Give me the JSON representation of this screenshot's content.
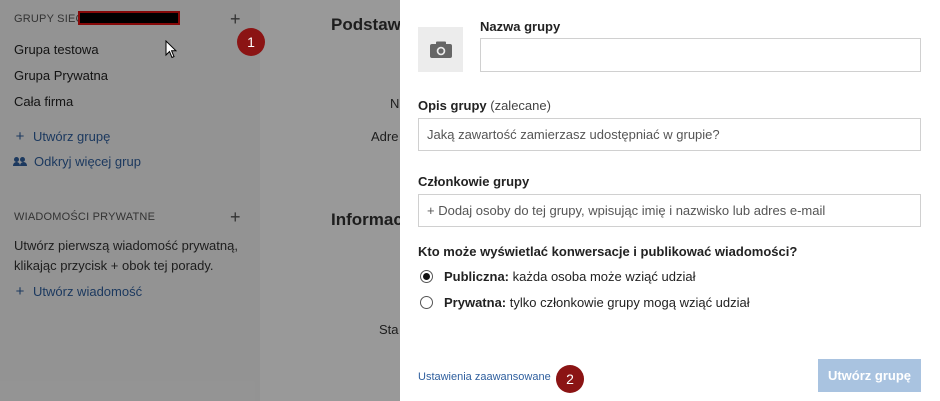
{
  "sidebar": {
    "groups_header": "GRUPY SIECI",
    "groups": [
      "Grupa testowa",
      "Grupa Prywatna",
      "Cała firma"
    ],
    "create_group": "Utwórz grupę",
    "discover_groups": "Odkryj więcej grup",
    "messages_header": "WIADOMOŚCI PRYWATNE",
    "messages_info_line1": "Utwórz pierwszą wiadomość prywatną,",
    "messages_info_line2": "klikając przycisk + obok tej porady.",
    "create_message": "Utwórz wiadomość"
  },
  "background_main": {
    "heading1": "Podstawo",
    "label_n": "N",
    "label_adre": "Adre",
    "heading2": "Informac",
    "label_sta": "Sta"
  },
  "markers": {
    "first": "1",
    "second": "2"
  },
  "dialog": {
    "name_label": "Nazwa grupy",
    "name_value": "",
    "description_label": "Opis grupy",
    "description_hint": "(zalecane)",
    "description_placeholder": "Jaką zawartość zamierzasz udostępniać w grupie?",
    "members_label": "Członkowie grupy",
    "members_placeholder": "+ Dodaj osoby do tej grupy, wpisując imię i nazwisko lub adres e-mail",
    "visibility_question": "Kto może wyświetlać konwersacje i publikować wiadomości?",
    "public_title": "Publiczna:",
    "public_desc": "każda osoba może wziąć udział",
    "private_title": "Prywatna:",
    "private_desc": "tylko członkowie grupy mogą wziąć udział",
    "selected_option": "public",
    "advanced_link": "Ustawienia zaawansowane",
    "submit_button": "Utwórz grupę"
  },
  "colors": {
    "link": "#2f5f9e",
    "marker": "#8b1414",
    "submit_disabled": "#a9c3e0",
    "overlay": "rgba(0,0,0,0.40)"
  }
}
